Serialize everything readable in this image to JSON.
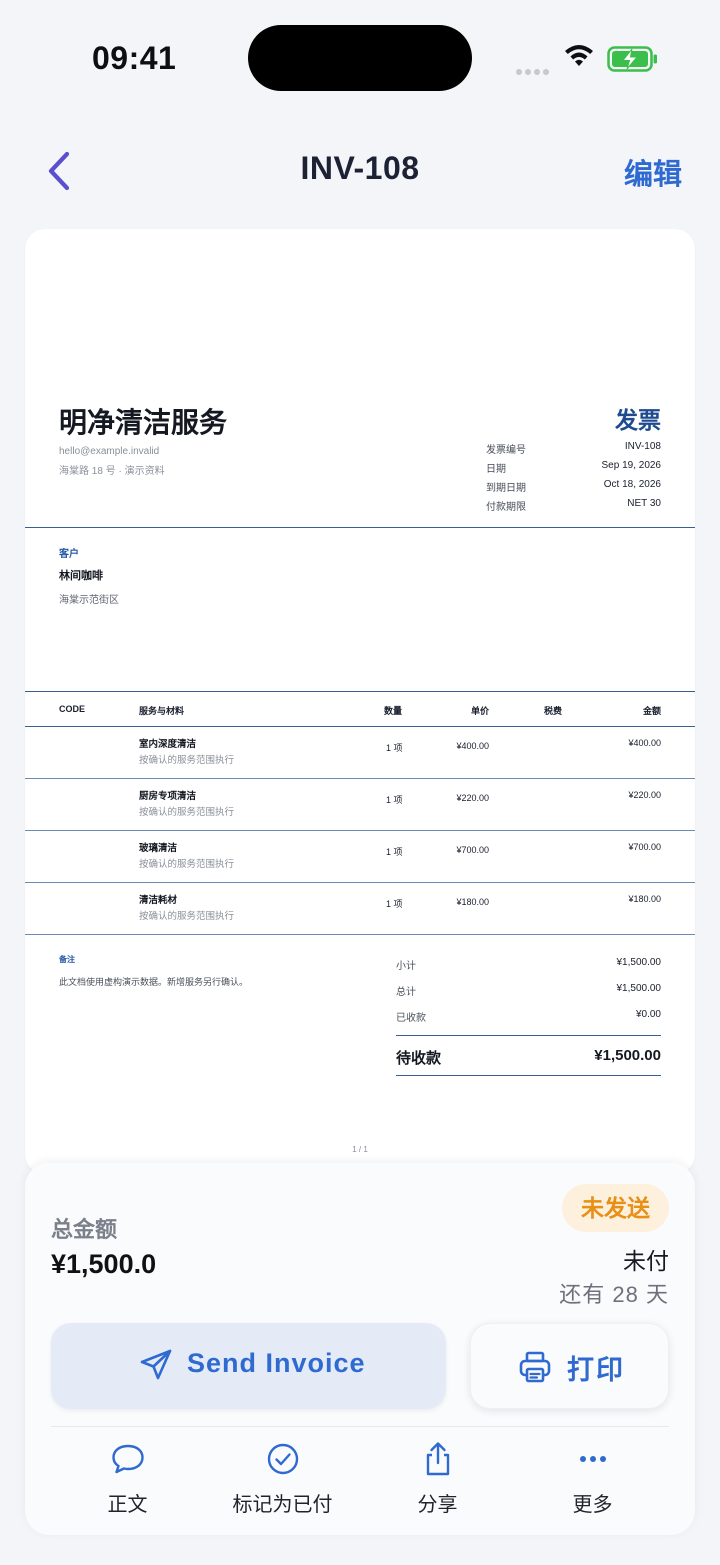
{
  "status_bar": {
    "time": "09:41"
  },
  "nav": {
    "title": "INV-108",
    "edit": "编辑"
  },
  "invoice": {
    "company": "明净清洁服务",
    "email": "hello@example.invalid",
    "address": "海棠路 18 号 · 演示资料",
    "doc_title": "发票",
    "meta": [
      {
        "label": "发票编号",
        "value": "INV-108"
      },
      {
        "label": "日期",
        "value": "Sep 19, 2026"
      },
      {
        "label": "到期日期",
        "value": "Oct 18, 2026"
      },
      {
        "label": "付款期限",
        "value": "NET 30"
      }
    ],
    "client": {
      "heading": "客户",
      "name": "林间咖啡",
      "address": "海棠示范街区"
    },
    "columns": {
      "code": "CODE",
      "item": "服务与材料",
      "qty": "数量",
      "price": "单价",
      "tax": "税费",
      "amount": "金额"
    },
    "items": [
      {
        "name": "室内深度清洁",
        "desc": "按确认的服务范围执行",
        "qty": "1 项",
        "price": "¥400.00",
        "amount": "¥400.00"
      },
      {
        "name": "厨房专项清洁",
        "desc": "按确认的服务范围执行",
        "qty": "1 项",
        "price": "¥220.00",
        "amount": "¥220.00"
      },
      {
        "name": "玻璃清洁",
        "desc": "按确认的服务范围执行",
        "qty": "1 项",
        "price": "¥700.00",
        "amount": "¥700.00"
      },
      {
        "name": "清洁耗材",
        "desc": "按确认的服务范围执行",
        "qty": "1 项",
        "price": "¥180.00",
        "amount": "¥180.00"
      }
    ],
    "notes_heading": "备注",
    "notes": "此文档使用虚构演示数据。新增服务另行确认。",
    "totals": [
      {
        "label": "小计",
        "value": "¥1,500.00"
      },
      {
        "label": "总计",
        "value": "¥1,500.00"
      },
      {
        "label": "已收款",
        "value": "¥0.00"
      }
    ],
    "due": {
      "label": "待收款",
      "value": "¥1,500.00"
    },
    "page": "1 / 1"
  },
  "summary": {
    "total_label": "总金额",
    "total_value": "¥1,500.0",
    "badge": "未发送",
    "status": "未付",
    "remaining": "还有 28 天"
  },
  "actions": {
    "send": "Send Invoice",
    "print": "打印",
    "bar": [
      {
        "label": "正文",
        "icon": "chat-bubble-icon"
      },
      {
        "label": "标记为已付",
        "icon": "check-circle-icon"
      },
      {
        "label": "分享",
        "icon": "share-icon"
      },
      {
        "label": "更多",
        "icon": "more-dots-icon"
      }
    ]
  },
  "colors": {
    "accent": "#2f6ad0",
    "badge_bg": "#fdf0dd",
    "badge_text": "#e88f16",
    "doc_blue": "#1e4a8f"
  }
}
